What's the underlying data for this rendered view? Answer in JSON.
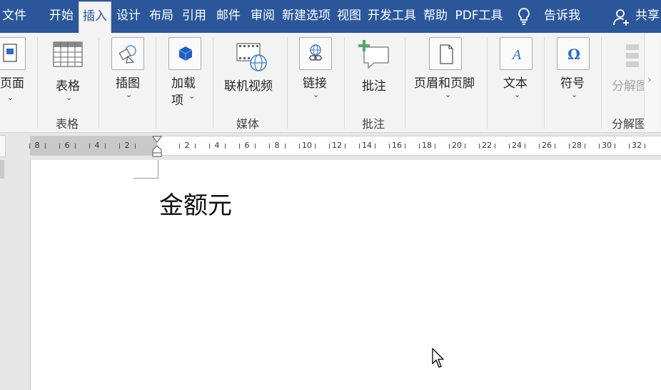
{
  "tabs": [
    {
      "label": "文件"
    },
    {
      "label": "开始"
    },
    {
      "label": "插入",
      "active": true
    },
    {
      "label": "设计"
    },
    {
      "label": "布局"
    },
    {
      "label": "引用"
    },
    {
      "label": "邮件"
    },
    {
      "label": "审阅"
    },
    {
      "label": "新建选项"
    },
    {
      "label": "视图"
    },
    {
      "label": "开发工具"
    },
    {
      "label": "帮助"
    },
    {
      "label": "PDF工具"
    }
  ],
  "tell_me": {
    "label": "告诉我",
    "icon": "lightbulb-icon"
  },
  "share": {
    "label": "共享",
    "icon": "user-add-icon"
  },
  "ribbon": {
    "pages": {
      "label": "页面"
    },
    "table": {
      "label": "表格",
      "group": "表格"
    },
    "illustrations": {
      "label": "插图"
    },
    "addins": {
      "label_line1": "加载",
      "label_line2": "项"
    },
    "online_video": {
      "label": "联机视频",
      "group": "媒体"
    },
    "links": {
      "label": "链接"
    },
    "comment": {
      "label": "批注",
      "group": "批注"
    },
    "header_footer": {
      "label": "页眉和页脚"
    },
    "text": {
      "label": "文本"
    },
    "symbols": {
      "label": "符号"
    },
    "decompose": {
      "label": "分解图",
      "group": "分解图"
    }
  },
  "ruler": {
    "left_labels": [
      "8",
      "6",
      "4",
      "2"
    ],
    "right_labels": [
      "2",
      "4",
      "6",
      "8",
      "10",
      "12",
      "14",
      "16",
      "18",
      "20",
      "22",
      "24",
      "26",
      "28",
      "30",
      "32"
    ]
  },
  "document": {
    "text": "金额元"
  },
  "colors": {
    "accent": "#2b579a",
    "ribbon_bg": "#f3f3f3"
  }
}
